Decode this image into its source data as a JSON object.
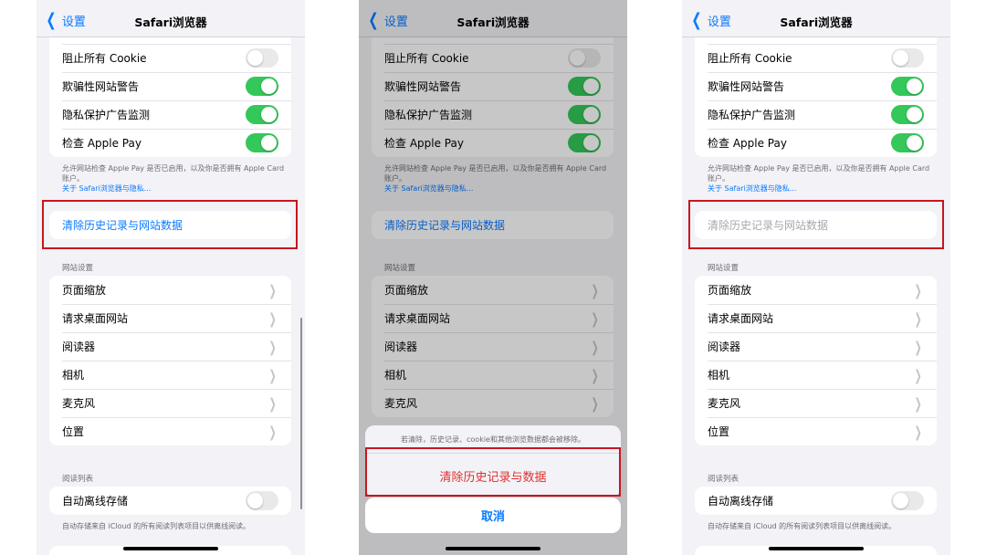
{
  "colors": {
    "accent": "#0a7aff",
    "toggle_on": "#34c759",
    "destructive": "#e0322b",
    "highlight_box": "#c8161d"
  },
  "nav": {
    "back_label": "设置",
    "title": "Safari浏览器"
  },
  "privacy_rows": [
    {
      "label": "阻止所有 Cookie",
      "toggle": "off"
    },
    {
      "label": "欺骗性网站警告",
      "toggle": "on"
    },
    {
      "label": "隐私保护广告监测",
      "toggle": "on"
    },
    {
      "label": "检查 Apple Pay",
      "toggle": "on"
    }
  ],
  "apple_pay_note": "允许网站检查 Apple Pay 是否已启用，以及你是否拥有 Apple Card账户。",
  "privacy_link": "关于 Safari浏览器与隐私...",
  "clear_history_label": "清除历史记录与网站数据",
  "website_settings": {
    "header": "网站设置",
    "items": [
      "页面缩放",
      "请求桌面网站",
      "阅读器",
      "相机",
      "麦克风",
      "位置"
    ]
  },
  "reading_list": {
    "header": "阅读列表",
    "offline_label": "自动离线存储",
    "offline_toggle": "off",
    "note": "自动存储来自 iCloud 的所有阅读列表项目以供离线阅读。"
  },
  "action_sheet": {
    "message": "若清除，历史记录、cookie和其他浏览数据都会被移除。",
    "confirm": "清除历史记录与数据",
    "cancel": "取消"
  }
}
